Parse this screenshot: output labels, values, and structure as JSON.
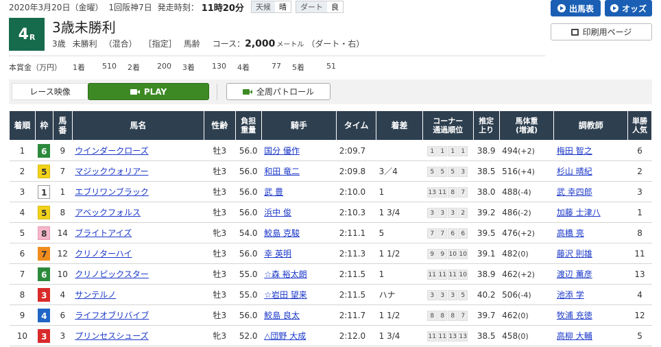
{
  "header": {
    "date": "2020年3月20日（金曜）",
    "meeting": "1回阪神7日",
    "post_time_label": "発走時刻：",
    "post_time": "11時20分",
    "weather_label": "天候",
    "weather": "晴",
    "track_label": "ダート",
    "track_condition": "良"
  },
  "race": {
    "number": "4",
    "suffix": "R",
    "name": "3歳未勝利",
    "age": "3歳",
    "class": "未勝利",
    "mix": "（混合）",
    "designation": "［指定］",
    "weight_rule": "馬齢",
    "course_label": "コース：",
    "distance": "2,000",
    "unit": "メートル",
    "surface": "（ダート・右）"
  },
  "buttons": {
    "entries": "出馬表",
    "odds": "オッズ",
    "print": "印刷用ページ"
  },
  "prize": {
    "title": "本賞金（万円）",
    "places": [
      {
        "label": "1着",
        "value": "510"
      },
      {
        "label": "2着",
        "value": "200"
      },
      {
        "label": "3着",
        "value": "130"
      },
      {
        "label": "4着",
        "value": "77"
      },
      {
        "label": "5着",
        "value": "51"
      }
    ]
  },
  "video": {
    "label": "レース映像",
    "play": "PLAY",
    "patrol": "全周パトロール"
  },
  "table": {
    "headers": {
      "rank": "着順",
      "waku": "枠",
      "umaban_1": "馬",
      "umaban_2": "番",
      "horse": "馬名",
      "sex_age": "性齢",
      "weight_1": "負担",
      "weight_2": "重量",
      "jockey": "騎手",
      "time": "タイム",
      "margin": "着差",
      "corner_1": "コーナー",
      "corner_2": "通過順位",
      "f3_1": "推定",
      "f3_2": "上り",
      "bw_1": "馬体重",
      "bw_2": "(増減)",
      "trainer": "調教師",
      "pop_1": "単勝",
      "pop_2": "人気"
    },
    "waku_colors": {
      "1": {
        "bg": "#ffffff",
        "fg": "#333333",
        "border": "#999999"
      },
      "3": {
        "bg": "#d92a2a",
        "fg": "#ffffff",
        "border": "#d92a2a"
      },
      "4": {
        "bg": "#1f66c6",
        "fg": "#ffffff",
        "border": "#1f66c6"
      },
      "5": {
        "bg": "#f2d21a",
        "fg": "#333333",
        "border": "#d8bb10"
      },
      "6": {
        "bg": "#2c8a3c",
        "fg": "#ffffff",
        "border": "#2c8a3c"
      },
      "7": {
        "bg": "#f08c1e",
        "fg": "#333333",
        "border": "#f08c1e"
      },
      "8": {
        "bg": "#f4b6c9",
        "fg": "#333333",
        "border": "#e89ab2"
      }
    },
    "rows": [
      {
        "rank": "1",
        "waku": "6",
        "umaban": "9",
        "horse": "ウインダークローズ",
        "sex_age": "牡3",
        "weight": "56.0",
        "jockey": "国分 優作",
        "time": "2:09.7",
        "margin": "",
        "corners": [
          "1",
          "1",
          "1",
          "1"
        ],
        "f3": "38.9",
        "bw": "494",
        "bw_diff": "(+2)",
        "trainer": "梅田 智之",
        "pop": "6"
      },
      {
        "rank": "2",
        "waku": "5",
        "umaban": "7",
        "horse": "マジックウォリアー",
        "sex_age": "牡3",
        "weight": "56.0",
        "jockey": "和田 竜二",
        "time": "2:09.8",
        "margin": "3／4",
        "corners": [
          "5",
          "5",
          "5",
          "3"
        ],
        "f3": "38.5",
        "bw": "516",
        "bw_diff": "(+4)",
        "trainer": "杉山 晴紀",
        "pop": "2"
      },
      {
        "rank": "3",
        "waku": "1",
        "umaban": "1",
        "horse": "エブリワンブラック",
        "sex_age": "牡3",
        "weight": "56.0",
        "jockey": "武 豊",
        "time": "2:10.0",
        "margin": "1",
        "corners": [
          "13",
          "11",
          "8",
          "7"
        ],
        "f3": "38.0",
        "bw": "488",
        "bw_diff": "(-4)",
        "trainer": "武 幸四郎",
        "pop": "3"
      },
      {
        "rank": "4",
        "waku": "5",
        "umaban": "8",
        "horse": "アベックフォルス",
        "sex_age": "牡3",
        "weight": "56.0",
        "jockey": "浜中 俊",
        "time": "2:10.3",
        "margin": "1 3/4",
        "corners": [
          "3",
          "3",
          "3",
          "2"
        ],
        "f3": "39.2",
        "bw": "486",
        "bw_diff": "(-2)",
        "trainer": "加藤 士津八",
        "pop": "1"
      },
      {
        "rank": "5",
        "waku": "8",
        "umaban": "14",
        "horse": "ブライトアイズ",
        "sex_age": "牝3",
        "weight": "54.0",
        "jockey": "鮫島 克駿",
        "time": "2:11.1",
        "margin": "5",
        "corners": [
          "7",
          "7",
          "6",
          "6"
        ],
        "f3": "39.5",
        "bw": "476",
        "bw_diff": "(+2)",
        "trainer": "高橋 亮",
        "pop": "8"
      },
      {
        "rank": "6",
        "waku": "7",
        "umaban": "12",
        "horse": "クリノターハイ",
        "sex_age": "牡3",
        "weight": "56.0",
        "jockey": "幸 英明",
        "time": "2:11.3",
        "margin": "1 1/2",
        "corners": [
          "9",
          "9",
          "10",
          "10"
        ],
        "f3": "39.1",
        "bw": "482",
        "bw_diff": "(0)",
        "trainer": "藤沢 則雄",
        "pop": "11"
      },
      {
        "rank": "7",
        "waku": "6",
        "umaban": "10",
        "horse": "クリノピックスター",
        "sex_age": "牡3",
        "weight": "55.0",
        "jockey": "☆森 裕太朗",
        "time": "2:11.5",
        "margin": "1",
        "corners": [
          "11",
          "11",
          "11",
          "10"
        ],
        "f3": "38.9",
        "bw": "462",
        "bw_diff": "(+2)",
        "trainer": "渡辺 薫彦",
        "pop": "13"
      },
      {
        "rank": "8",
        "waku": "3",
        "umaban": "4",
        "horse": "サンテルノ",
        "sex_age": "牡3",
        "weight": "55.0",
        "jockey": "☆岩田 望来",
        "time": "2:11.5",
        "margin": "ハナ",
        "corners": [
          "3",
          "3",
          "3",
          "5"
        ],
        "f3": "40.2",
        "bw": "506",
        "bw_diff": "(-4)",
        "trainer": "池添 学",
        "pop": "4"
      },
      {
        "rank": "9",
        "waku": "4",
        "umaban": "6",
        "horse": "ライフオブリバイブ",
        "sex_age": "牡3",
        "weight": "56.0",
        "jockey": "鮫島 良太",
        "time": "2:11.7",
        "margin": "1 1/2",
        "corners": [
          "8",
          "8",
          "8",
          "7"
        ],
        "f3": "39.7",
        "bw": "462",
        "bw_diff": "(0)",
        "trainer": "牧浦 充徳",
        "pop": "12"
      },
      {
        "rank": "10",
        "waku": "3",
        "umaban": "3",
        "horse": "プリンセスシューズ",
        "sex_age": "牝3",
        "weight": "52.0",
        "jockey": "△団野 大成",
        "time": "2:12.0",
        "margin": "1 3/4",
        "corners": [
          "11",
          "11",
          "13",
          "13"
        ],
        "f3": "38.5",
        "bw": "458",
        "bw_diff": "(0)",
        "trainer": "高柳 大輔",
        "pop": "5"
      }
    ]
  }
}
